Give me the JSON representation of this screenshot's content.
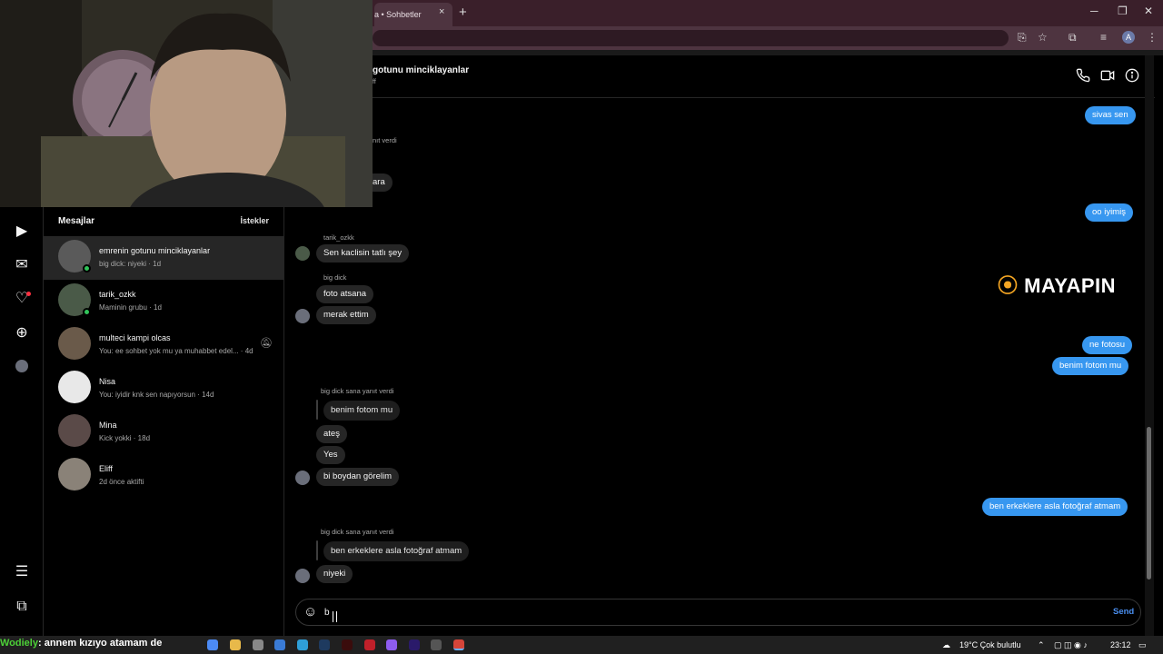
{
  "browser": {
    "tab_title": "a • Sohbetler",
    "tab_close": "×",
    "new_tab": "+",
    "minimize": "─",
    "maximize": "❐",
    "close": "✕",
    "profile_initial": "A"
  },
  "sidebar": {
    "icons": [
      "reels-icon",
      "messenger-icon",
      "heart-icon",
      "create-icon",
      "profile-icon",
      "menu-icon",
      "more-icon"
    ]
  },
  "inbox": {
    "title": "Mesajlar",
    "requests_label": "İstekler",
    "conversations": [
      {
        "name": "emrenin gotunu minciklayanlar",
        "preview": "big dick: niyeki · 1d",
        "online": true,
        "active": true,
        "avatar_color": "#5a5a5a"
      },
      {
        "name": "tarik_ozkk",
        "preview": "Maminin grubu · 1d",
        "online": true,
        "active": false,
        "avatar_color": "#4a5a48"
      },
      {
        "name": "multeci kampi olcas",
        "preview": "You: ee sohbet yok mu ya muhabbet edel... · 4d",
        "online": false,
        "active": false,
        "muted": true,
        "avatar_color": "#6a5a4a"
      },
      {
        "name": "Nisa",
        "preview": "You: iyidir knk sen napıyorsun · 14d",
        "online": false,
        "active": false,
        "avatar_color": "#e8e8e8"
      },
      {
        "name": "Mina",
        "preview": "Kick yokki · 18d",
        "online": false,
        "active": false,
        "avatar_color": "#5a4a48"
      },
      {
        "name": "Eliff",
        "preview": "2d önce aktifti",
        "online": false,
        "active": false,
        "avatar_color": "#8a8278"
      }
    ]
  },
  "chat": {
    "title": "gotunu minciklayanlar",
    "subtitle": "ff",
    "header_icons": [
      "phone-icon",
      "video-icon",
      "info-icon"
    ],
    "messages": {
      "m1": "sivas sen",
      "m2_meta": "nıt verdi",
      "m3": "ara",
      "m4": "oo iyimiş",
      "m5_sender": "tarik_ozkk",
      "m5": "Sen kaclisin tatlı şey",
      "m6_sender": "big dick",
      "m6": "foto atsana",
      "m7": "merak ettim",
      "m8": "ne fotosu",
      "m9": "benim fotom mu",
      "m10_meta": "big dick sana yanıt verdi",
      "m10_quote": "benim fotom mu",
      "m11": "ateş",
      "m12": "Yes",
      "m13": "bi boydan görelim",
      "m14": "ben erkeklere asla fotoğraf atmam",
      "m15_meta": "big dick sana yanıt verdi",
      "m15_quote": "ben erkeklere asla fotoğraf atmam",
      "m16": "niyeki"
    },
    "watermark": "MAYAPIN",
    "composer_value": "b",
    "send_label": "Send"
  },
  "taskbar": {
    "ticker_name": "Wodiely",
    "ticker_text": ": annem kızıyo atamam de",
    "weather": "19°C  Çok bulutlu",
    "time": "23:12"
  }
}
